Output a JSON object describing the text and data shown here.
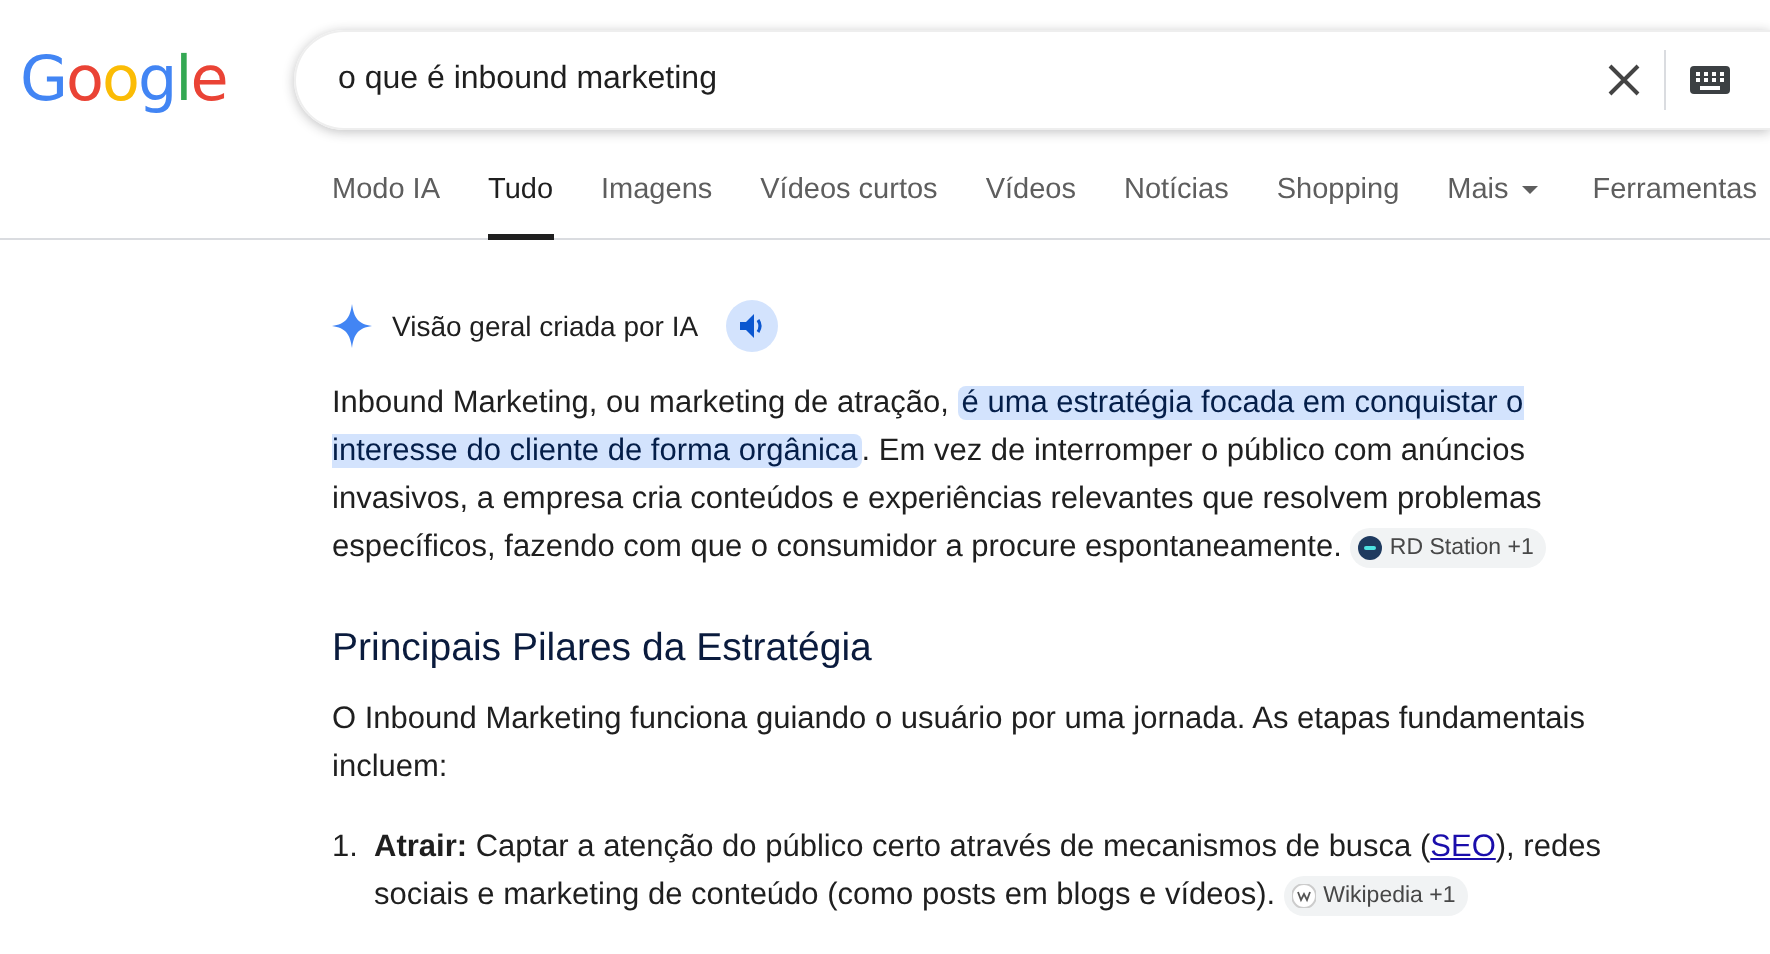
{
  "logo": "Google",
  "search": {
    "value": "o que é inbound marketing"
  },
  "tabs": [
    {
      "label": "Modo IA",
      "selected": false
    },
    {
      "label": "Tudo",
      "selected": true
    },
    {
      "label": "Imagens",
      "selected": false
    },
    {
      "label": "Vídeos curtos",
      "selected": false
    },
    {
      "label": "Vídeos",
      "selected": false
    },
    {
      "label": "Notícias",
      "selected": false
    },
    {
      "label": "Shopping",
      "selected": false
    },
    {
      "label": "Mais",
      "selected": false,
      "kind": "dropdown"
    },
    {
      "label": "Ferramentas",
      "selected": false
    }
  ],
  "overview": {
    "title": "Visão geral criada por IA",
    "intro": {
      "segments": [
        {
          "text": "Inbound Marketing, ou marketing de atração, ",
          "highlighted": false
        },
        {
          "text": "é uma estratégia focada em conquistar o interesse do cliente de forma orgânica",
          "highlighted": true
        },
        {
          "text": ". Em vez de interromper o público com anúncios invasivos, a empresa cria conteúdos e experiências relevantes que resolvem problemas específicos, fazendo com que o consumidor a procure espontaneamente.",
          "highlighted": false
        }
      ],
      "source": {
        "label": "RD Station +1",
        "kind": "rd"
      }
    },
    "heading": "Principais Pilares da Estratégia",
    "lead": "O Inbound Marketing funciona guiando o usuário por uma jornada. As etapas fundamentais incluem:",
    "steps": [
      {
        "number": "1.",
        "before": "**Atrair:** Captar a atenção do público certo através de mecanismos de busca (",
        "link": "SEO",
        "after": "), redes sociais e marketing de conteúdo (como posts em blogs e vídeos).",
        "source": {
          "label": "Wikipedia +1",
          "kind": "wiki"
        }
      }
    ]
  }
}
